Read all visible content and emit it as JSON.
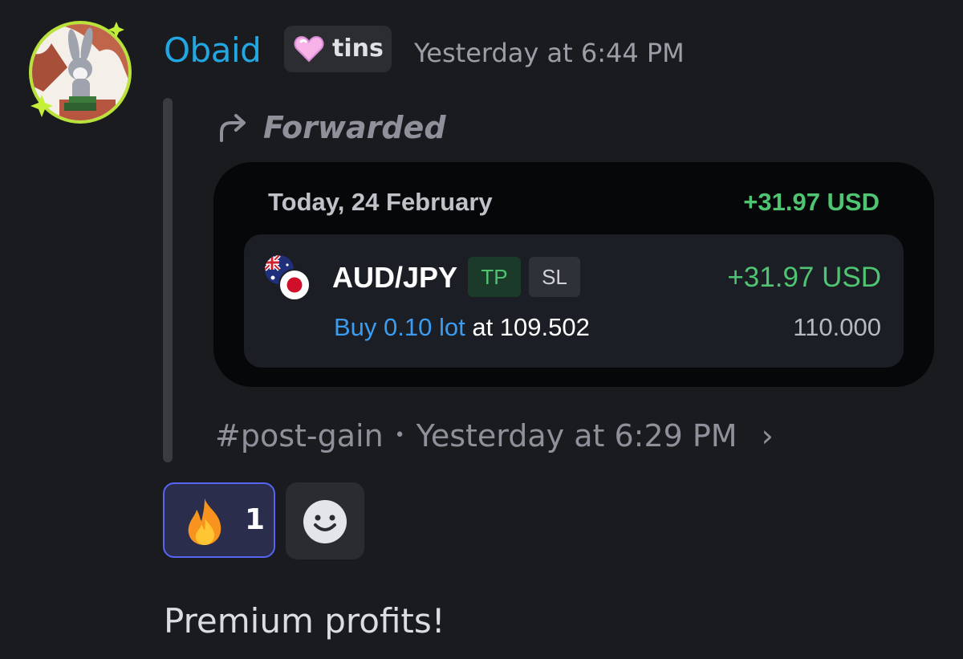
{
  "author": {
    "name": "Obaid",
    "avatar_icon": "bugs-bunny-avatar-icon",
    "name_color": "#23a7e3"
  },
  "tag": {
    "icon": "heart-icon",
    "label": "tins"
  },
  "message_timestamp": "Yesterday at 6:44 PM",
  "forward": {
    "icon": "forward-arrow-icon",
    "label": "Forwarded"
  },
  "trade_card": {
    "date": "Today, 24 February",
    "total": "+31.97 USD",
    "trade": {
      "flags_icon": "aud-jpy-flags-icon",
      "pair": "AUD/JPY",
      "tp_label": "TP",
      "sl_label": "SL",
      "profit": "+31.97 USD",
      "side_volume": "Buy 0.10 lot",
      "at_price": "at 109.502",
      "close_price": "110.000"
    },
    "colors": {
      "profit_green": "#4fc471",
      "buy_blue": "#3b9cf0"
    }
  },
  "source": {
    "channel": "#post-gain",
    "separator": "•",
    "timestamp": "Yesterday at 6:29 PM",
    "chevron": "›"
  },
  "reactions": [
    {
      "emoji_icon": "fire-icon",
      "count": "1"
    }
  ],
  "add_reaction_icon": "smiley-icon",
  "message_text": "Premium profits!"
}
